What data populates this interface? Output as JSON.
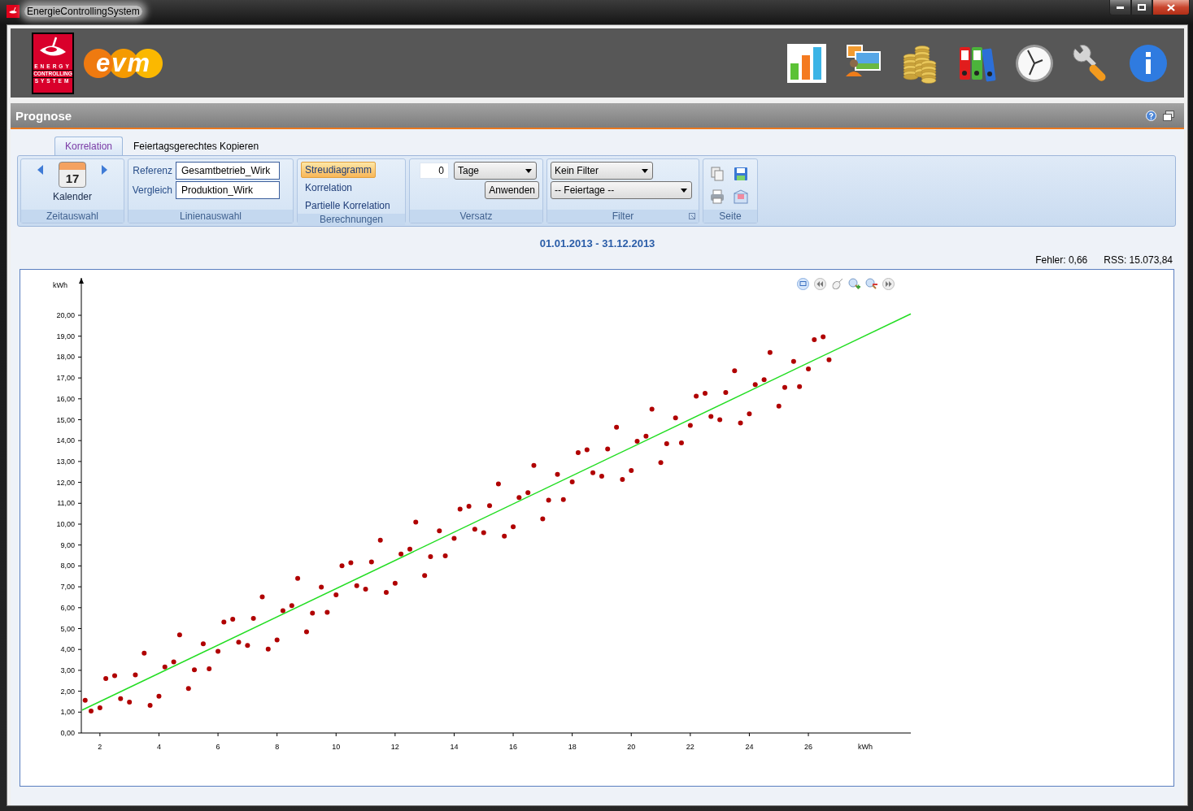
{
  "window": {
    "title": "EnergieControllingSystem"
  },
  "header": {
    "logo_lines": [
      "ENERGY",
      "CONTROLLING",
      "SYSTEM"
    ],
    "brand": "evm"
  },
  "panel": {
    "title": "Prognose"
  },
  "tabs": [
    {
      "label": "Korrelation",
      "selected": true
    },
    {
      "label": "Feiertagsgerechtes Kopieren",
      "selected": false
    }
  ],
  "ribbon": [
    {
      "kind": "time",
      "label": "Zeitauswahl",
      "button": "Kalender",
      "day": "17"
    },
    {
      "kind": "lines",
      "label": "Linienauswahl",
      "fields": [
        {
          "label": "Referenz",
          "value": "Gesamtbetrieb_Wirk"
        },
        {
          "label": "Vergleich",
          "value": "Produktion_Wirk"
        }
      ]
    },
    {
      "kind": "calc",
      "label": "Berechnungen",
      "options": [
        {
          "label": "Streudiagramm",
          "selected": true
        },
        {
          "label": "Korrelation",
          "selected": false
        },
        {
          "label": "Partielle Korrelation",
          "selected": false
        }
      ]
    },
    {
      "kind": "offset",
      "label": "Versatz",
      "amount": "0",
      "unit": "Tage",
      "button": "Anwenden"
    },
    {
      "kind": "filter",
      "label": "Filter",
      "dropdowns": [
        "Kein Filter",
        "-- Feiertage --"
      ]
    },
    {
      "kind": "page",
      "label": "Seite"
    }
  ],
  "range": "01.01.2013 - 31.12.2013",
  "stats": [
    "Fehler: 0,66",
    "RSS: 15.073,84"
  ],
  "chart": {
    "chart_data": {
      "type": "scatter",
      "xlabel": "kWh",
      "ylabel": "kWh",
      "xlim": [
        1.37,
        29.47
      ],
      "ylim": [
        0,
        21.79
      ],
      "xticks": [
        2,
        4,
        6,
        8,
        10,
        12,
        14,
        16,
        18,
        20,
        22,
        24,
        26
      ],
      "yticks": [
        {
          "value": 0,
          "label": "0,00"
        },
        {
          "value": 1,
          "label": "1,00"
        },
        {
          "value": 2,
          "label": "2,00"
        },
        {
          "value": 3,
          "label": "3,00"
        },
        {
          "value": 4,
          "label": "4,00"
        },
        {
          "value": 5,
          "label": "5,00"
        },
        {
          "value": 6,
          "label": "6,00"
        },
        {
          "value": 7,
          "label": "7,00"
        },
        {
          "value": 8,
          "label": "8,00"
        },
        {
          "value": 9,
          "label": "9,00"
        },
        {
          "value": 10,
          "label": "10,00"
        },
        {
          "value": 11,
          "label": "11,00"
        },
        {
          "value": 12,
          "label": "12,00"
        },
        {
          "value": 13,
          "label": "13,00"
        },
        {
          "value": 14,
          "label": "14,00"
        },
        {
          "value": 15,
          "label": "15,00"
        },
        {
          "value": 16,
          "label": "16,00"
        },
        {
          "value": 17,
          "label": "17,00"
        },
        {
          "value": 18,
          "label": "18,00"
        },
        {
          "value": 19,
          "label": "19,00"
        },
        {
          "value": 20,
          "label": "20,00"
        }
      ],
      "series": [
        {
          "color": "#b00000",
          "x": [
            1.5,
            2,
            2.5,
            3,
            3.5,
            4,
            4.5,
            5,
            5.5,
            6,
            6.5,
            7,
            7.5,
            8,
            8.5,
            9,
            9.5,
            10,
            10.5,
            11,
            11.5,
            12,
            12.5,
            13,
            13.5,
            14,
            14.5,
            15,
            15.5,
            16,
            16.5,
            17,
            17.5,
            18,
            18.5,
            19,
            19.5,
            20,
            20.5,
            21,
            21.5,
            22,
            22.5,
            23,
            23.5,
            24,
            24.5,
            25,
            25.5,
            26,
            26.5,
            1.7,
            2.2,
            2.7,
            3.2,
            3.7,
            4.2,
            4.7,
            5.2,
            5.7,
            6.2,
            6.7,
            7.2,
            7.7,
            8.2,
            8.7,
            9.2,
            9.7,
            10.2,
            10.7,
            11.2,
            11.7,
            12.2,
            12.7,
            13.2,
            13.7,
            14.2,
            14.7,
            15.2,
            15.7,
            16.2,
            16.7,
            17.2,
            17.7,
            18.2,
            18.7,
            19.2,
            19.7,
            20.2,
            20.7,
            21.2,
            21.7,
            22.2,
            22.7,
            23.2,
            23.7,
            24.2,
            24.7,
            25.2,
            25.7,
            26.2,
            26.7
          ],
          "values": [
            1.57,
            1.21,
            2.74,
            1.48,
            3.82,
            1.76,
            3.4,
            2.13,
            4.27,
            3.91,
            5.45,
            4.19,
            6.52,
            4.46,
            6.1,
            4.84,
            6.98,
            6.61,
            8.15,
            6.89,
            9.23,
            7.17,
            8.8,
            7.54,
            9.68,
            9.32,
            10.86,
            9.59,
            11.93,
            9.87,
            11.51,
            10.25,
            12.38,
            12.02,
            13.56,
            12.3,
            14.64,
            12.57,
            14.21,
            12.95,
            15.09,
            14.73,
            16.26,
            15,
            17.34,
            15.28,
            16.92,
            15.65,
            17.79,
            17.43,
            18.97,
            1.05,
            2.61,
            1.64,
            2.78,
            1.32,
            3.16,
            4.7,
            3.03,
            3.07,
            5.31,
            4.35,
            5.49,
            4.02,
            5.86,
            7.4,
            5.74,
            5.78,
            8.01,
            7.05,
            8.19,
            6.73,
            8.57,
            10.1,
            8.44,
            8.48,
            10.72,
            9.76,
            10.89,
            9.43,
            11.27,
            12.81,
            11.15,
            11.18,
            13.42,
            12.46,
            13.6,
            12.14,
            13.97,
            15.51,
            13.85,
            13.89,
            16.13,
            15.16,
            16.3,
            14.84,
            16.68,
            18.22,
            16.55,
            16.59,
            18.83,
            17.87
          ]
        },
        {
          "type": "line",
          "color": "#22dd22",
          "x": [
            1.4,
            29.47
          ],
          "values": [
            1.1,
            20.07
          ]
        }
      ]
    }
  }
}
